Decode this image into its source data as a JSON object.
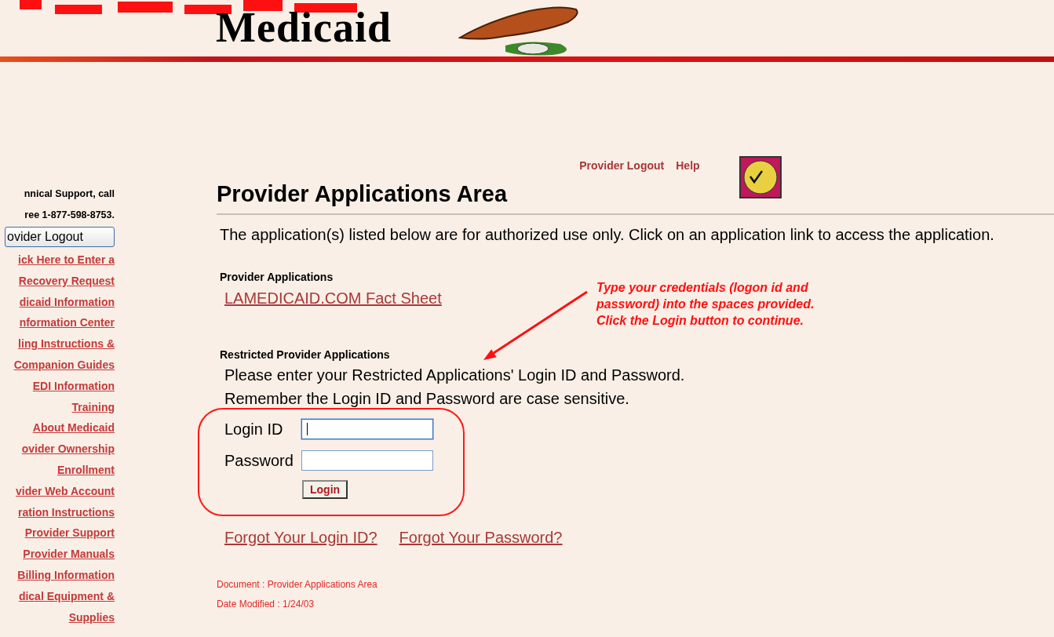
{
  "header": {
    "title": "Medicaid"
  },
  "sidebar": {
    "support_lines": [
      "nnical Support, call",
      "ree 1-877-598-8753."
    ],
    "logout_button": "ovider Logout",
    "links": [
      "ick Here to Enter a",
      "Recovery Request",
      "dicaid Information",
      "nformation Center",
      "ling Instructions &",
      "Companion Guides",
      "EDI Information",
      "Training",
      "About Medicaid",
      "ovider Ownership",
      "Enrollment",
      "vider Web Account",
      "ration Instructions",
      "Provider Support",
      "Provider Manuals",
      "Billing Information",
      "dical Equipment &",
      "Supplies"
    ]
  },
  "top_links": [
    "Provider Logout",
    "Help"
  ],
  "page_title": "Provider Applications Area",
  "intro": "The application(s) listed below are for authorized use only. Click on an application link to access the application.",
  "provider_applications": {
    "heading": "Provider Applications",
    "links": [
      "LAMEDICAID.COM Fact Sheet"
    ]
  },
  "restricted": {
    "heading": "Restricted Provider Applications",
    "lines": [
      "Please enter your Restricted Applications' Login ID and Password.",
      "Remember the Login ID and Password are case sensitive."
    ],
    "fields": [
      {
        "label": "Login ID",
        "focused": true
      },
      {
        "label": "Password",
        "focused": false
      }
    ],
    "login_button": "Login"
  },
  "forgot_links": [
    "Forgot Your Login ID?",
    "Forgot Your Password?"
  ],
  "footer": [
    "Document : Provider Applications Area",
    "Date Modified : 1/24/03"
  ],
  "annotation": {
    "text": "Type your credentials (logon id and password) into the spaces provided.  Click the Login button to continue."
  }
}
